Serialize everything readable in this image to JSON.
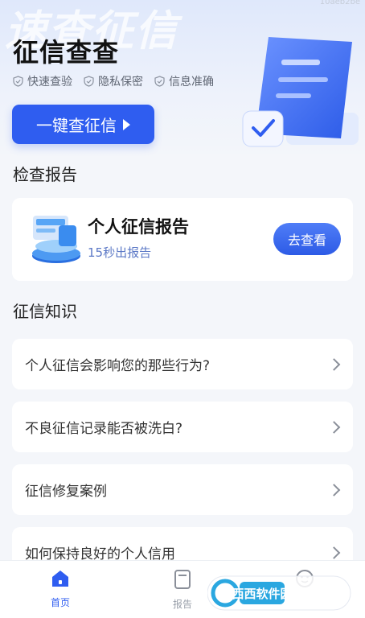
{
  "hero": {
    "watermark": "速查征信",
    "corner_text": "10aeb2be",
    "title": "征信查查",
    "features": [
      "快速查验",
      "隐私保密",
      "信息准确"
    ],
    "cta_label": "一键查征信"
  },
  "report_section": {
    "title": "检查报告",
    "card": {
      "name": "个人征信报告",
      "subtitle": "15秒出报告",
      "button": "去查看"
    }
  },
  "knowledge": {
    "title": "征信知识",
    "items": [
      "个人征信会影响您的那些行为?",
      "不良征信记录能否被洗白?",
      "征信修复案例",
      "如何保持良好的个人信用"
    ]
  },
  "tabbar": {
    "tabs": [
      {
        "label": "首页",
        "active": true
      },
      {
        "label": "报告",
        "active": false
      },
      {
        "label": "",
        "active": false
      }
    ]
  },
  "overlay_logo": "西西软件园",
  "colors": {
    "accent": "#2f5df0",
    "background": "#f4f6fa"
  }
}
